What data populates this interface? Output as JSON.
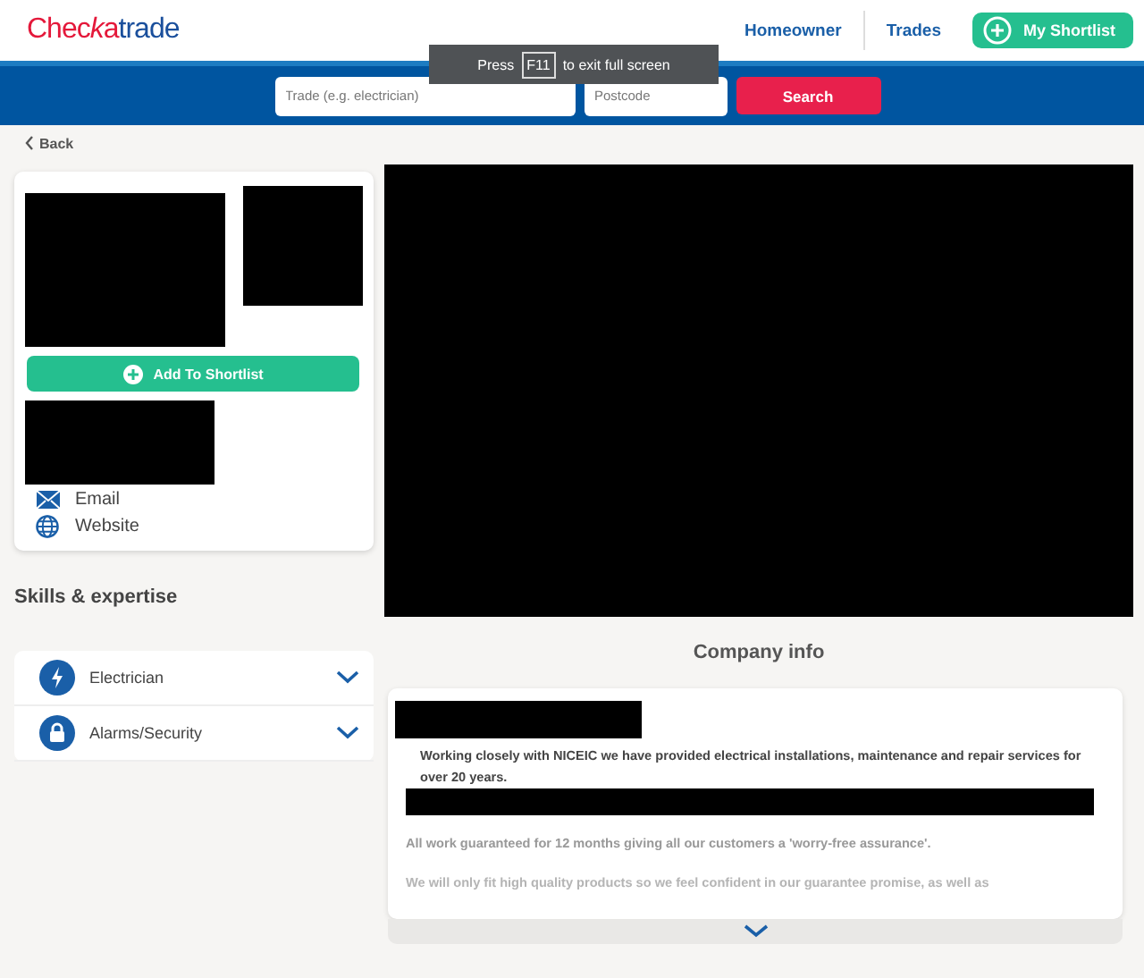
{
  "header": {
    "logo": {
      "part_1": "Chec",
      "part_2": "k",
      "part_3": "a",
      "part_4": "trade"
    },
    "nav": [
      "Homeowner",
      "Trades"
    ],
    "shortlist_button": "My Shortlist"
  },
  "search": {
    "trade_placeholder": "Trade (e.g. electrician)",
    "postcode_placeholder": "Postcode",
    "button": "Search"
  },
  "fullscreen_notice": {
    "before": "Press",
    "key": "F11",
    "after": "to exit full screen"
  },
  "back_link": "Back",
  "profile_card": {
    "add_button": "Add To Shortlist",
    "contacts": [
      {
        "kind": "email",
        "label": "Email"
      },
      {
        "kind": "website",
        "label": "Website"
      }
    ]
  },
  "skills": {
    "title": "Skills & expertise",
    "items": [
      {
        "kind": "electric",
        "label": "Electrician",
        "expanded": false
      },
      {
        "kind": "lock",
        "label": "Alarms/Security",
        "expanded": false
      }
    ]
  },
  "company_info": {
    "title": "Company info",
    "paragraphs": [
      {
        "kind": "main",
        "text": "Working closely with NICEIC we have provided electrical installations, maintenance and repair services for over 20 years."
      },
      {
        "kind": "faded",
        "text": "All work guaranteed for 12 months giving all our customers a 'worry-free assurance'."
      },
      {
        "kind": "fading",
        "text": "We will only fit high quality products so we feel confident in our guarantee promise, as well as"
      }
    ]
  }
}
